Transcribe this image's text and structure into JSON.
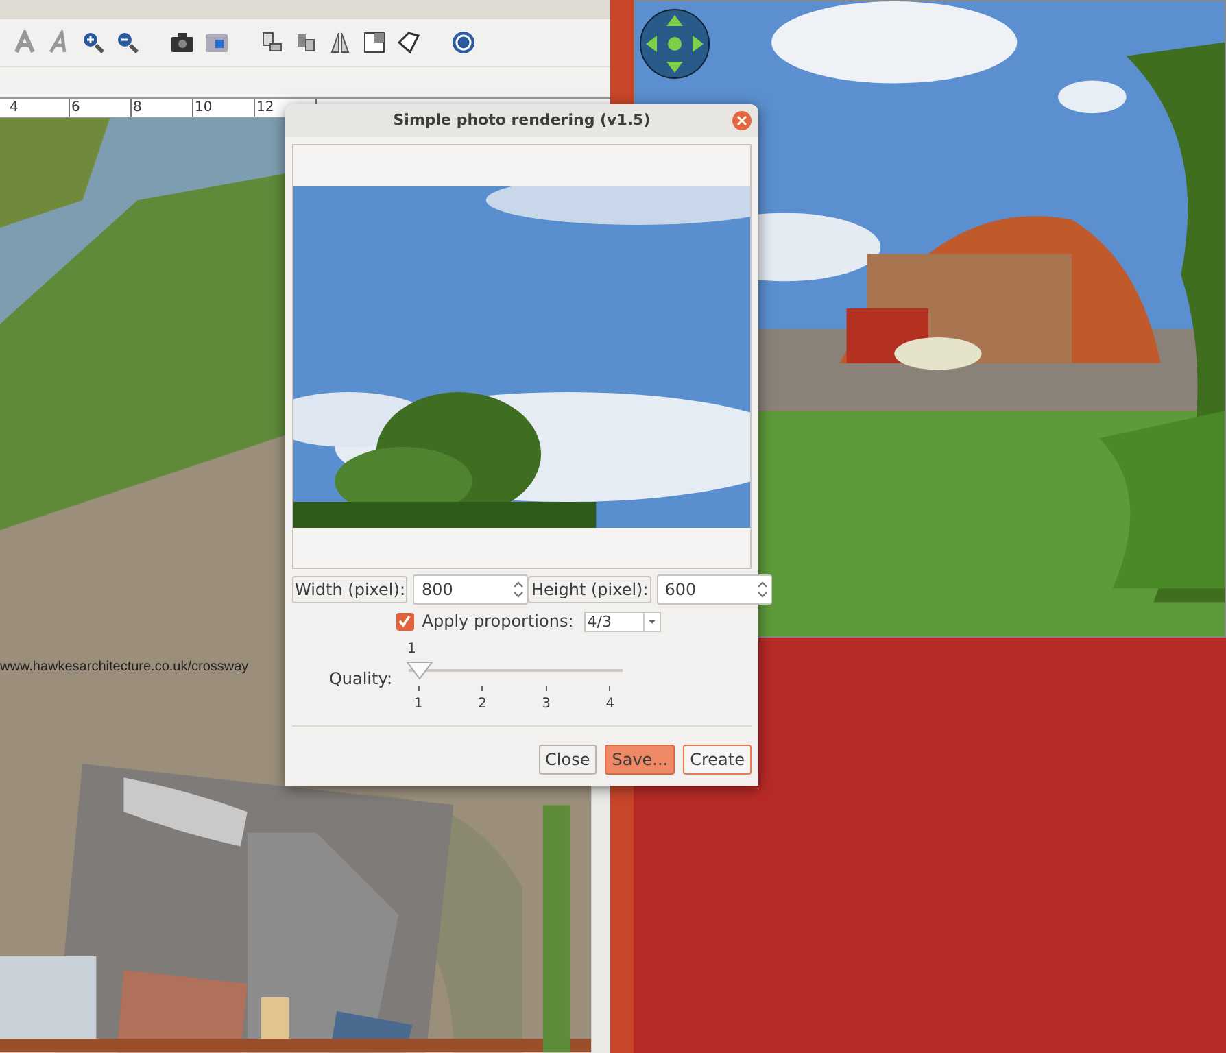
{
  "ruler": {
    "ticks": [
      "4",
      "6",
      "8",
      "10",
      "12"
    ]
  },
  "plan": {
    "caption": "www.hawkesarchitecture.co.uk/crossway"
  },
  "dialog": {
    "title": "Simple photo rendering (v1.5)",
    "width": {
      "label": "Width (pixel):",
      "value": "800"
    },
    "height": {
      "label": "Height (pixel):",
      "value": "600"
    },
    "proportions": {
      "label": "Apply proportions:",
      "checked": true,
      "value": "4/3"
    },
    "quality": {
      "label": "Quality:",
      "reading": "1",
      "level": 0,
      "ticks": [
        "1",
        "2",
        "3",
        "4"
      ]
    },
    "buttons": [
      {
        "label": "Close",
        "kind": "plain"
      },
      {
        "label": "Save...",
        "kind": "highlighted"
      },
      {
        "label": "Create",
        "kind": "focused"
      }
    ]
  }
}
